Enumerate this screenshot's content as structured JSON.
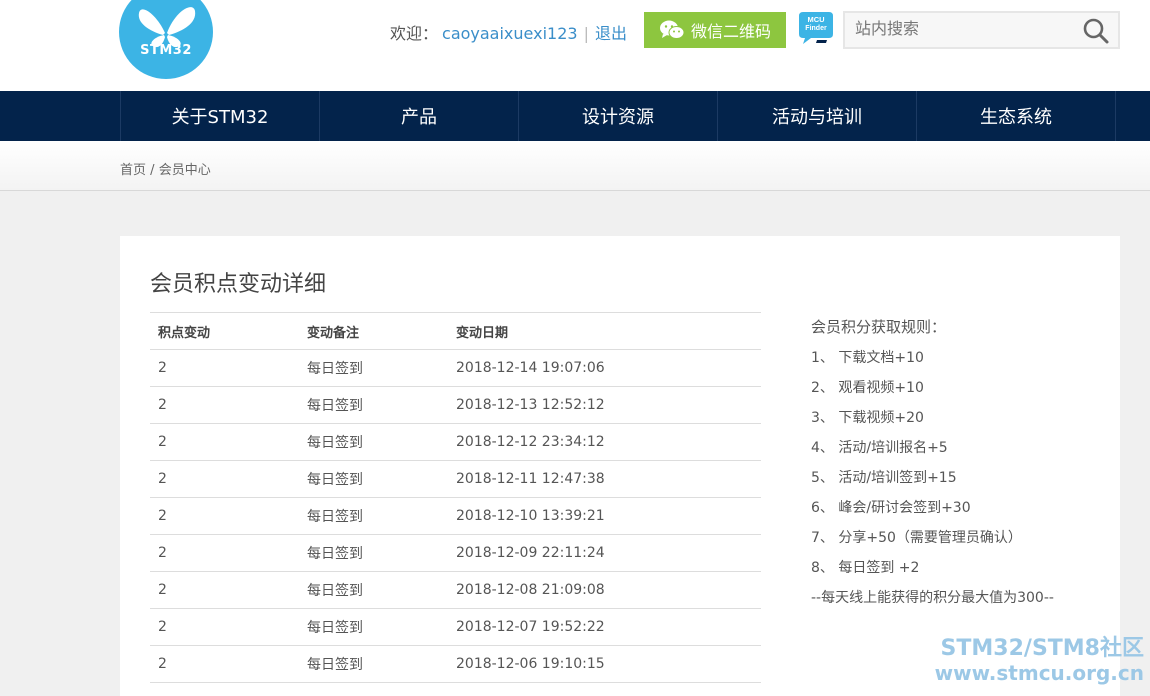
{
  "header": {
    "logo_text": "STM32",
    "welcome_label": "欢迎：",
    "username": "caoyaaixuexi123",
    "separator": "|",
    "logout_label": "退出",
    "wechat_label": "微信二维码",
    "mcu_finder_line1": "MCU",
    "mcu_finder_line2": "Finder",
    "search_placeholder": "站内搜索"
  },
  "nav": {
    "items": [
      "关于STM32",
      "产品",
      "设计资源",
      "活动与培训",
      "生态系统"
    ]
  },
  "breadcrumb": {
    "home": "首页",
    "separator": "/",
    "current": "会员中心"
  },
  "main": {
    "title": "会员积点变动详细",
    "table": {
      "headers": [
        "积点变动",
        "变动备注",
        "变动日期"
      ],
      "rows": [
        [
          "2",
          "每日签到",
          "2018-12-14 19:07:06"
        ],
        [
          "2",
          "每日签到",
          "2018-12-13 12:52:12"
        ],
        [
          "2",
          "每日签到",
          "2018-12-12 23:34:12"
        ],
        [
          "2",
          "每日签到",
          "2018-12-11 12:47:38"
        ],
        [
          "2",
          "每日签到",
          "2018-12-10 13:39:21"
        ],
        [
          "2",
          "每日签到",
          "2018-12-09 22:11:24"
        ],
        [
          "2",
          "每日签到",
          "2018-12-08 21:09:08"
        ],
        [
          "2",
          "每日签到",
          "2018-12-07 19:52:22"
        ],
        [
          "2",
          "每日签到",
          "2018-12-06 19:10:15"
        ]
      ]
    },
    "rules": {
      "title": "会员积分获取规则：",
      "items": [
        "1、 下载文档+10",
        "2、 观看视频+10",
        "3、 下载视频+20",
        "4、 活动/培训报名+5",
        "5、 活动/培训签到+15",
        "6、 峰会/研讨会签到+30",
        "7、 分享+50（需要管理员确认）",
        "8、 每日签到 +2"
      ],
      "note": "--每天线上能获得的积分最大值为300--"
    }
  },
  "watermark": {
    "line1": "STM32/STM8社区",
    "line2": "www.stmcu.org.cn"
  },
  "colors": {
    "nav_bg": "#03234b",
    "wechat_green": "#8dc63f",
    "logo_blue": "#3cb4e5",
    "link_blue": "#3a8ec9"
  },
  "icons": {
    "logo": "butterfly-logo-icon",
    "wechat": "wechat-icon",
    "mcu_finder": "mcu-finder-icon",
    "search": "search-icon"
  }
}
